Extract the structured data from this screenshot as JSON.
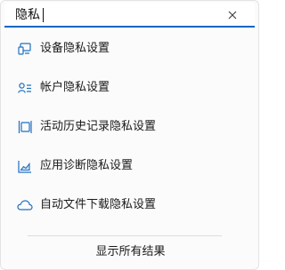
{
  "search": {
    "query": "隐私",
    "clear_icon": "close-icon"
  },
  "results": [
    {
      "label": "设备隐私设置",
      "icon": "devices-icon"
    },
    {
      "label": "帐户隐私设置",
      "icon": "account-icon"
    },
    {
      "label": "活动历史记录隐私设置",
      "icon": "timeline-icon"
    },
    {
      "label": "应用诊断隐私设置",
      "icon": "diagnostics-chart-icon"
    },
    {
      "label": "自动文件下载隐私设置",
      "icon": "cloud-icon"
    }
  ],
  "footer": {
    "show_all_label": "显示所有结果"
  },
  "colors": {
    "accent": "#0067c0",
    "icon": "#1f6fc0"
  }
}
